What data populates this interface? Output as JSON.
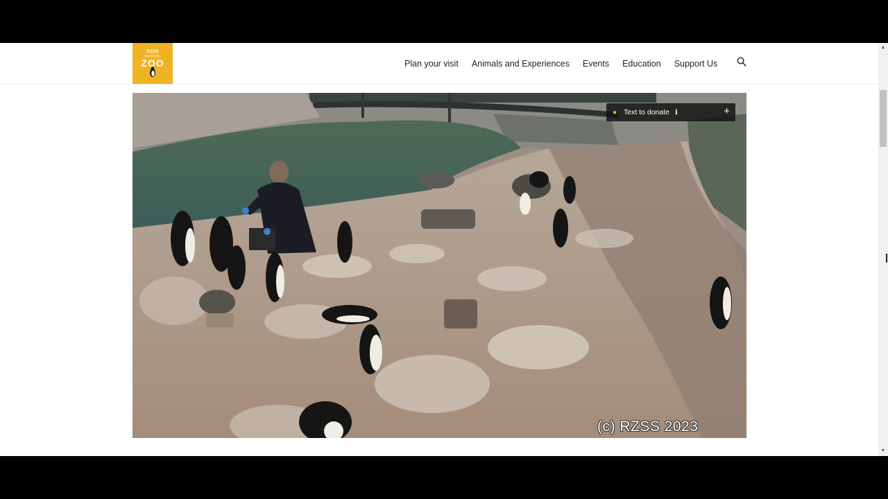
{
  "logo": {
    "org": "RZSS",
    "sub": "EDINBURGH",
    "name": "ZOO"
  },
  "nav": {
    "items": [
      {
        "label": "Plan your visit"
      },
      {
        "label": "Animals and Experiences"
      },
      {
        "label": "Events"
      },
      {
        "label": "Education"
      },
      {
        "label": "Support Us"
      }
    ],
    "search_icon": "search-icon"
  },
  "webcam": {
    "donate_label": "Text to donate",
    "donate_icon": "paw-icon",
    "info_icon": "info-icon",
    "expand_icon": "plus-icon",
    "watermark": "(c) RZSS 2023"
  },
  "colors": {
    "brand": "#f0b323",
    "header_bg": "#ffffff",
    "pill_bg": "#141414"
  }
}
